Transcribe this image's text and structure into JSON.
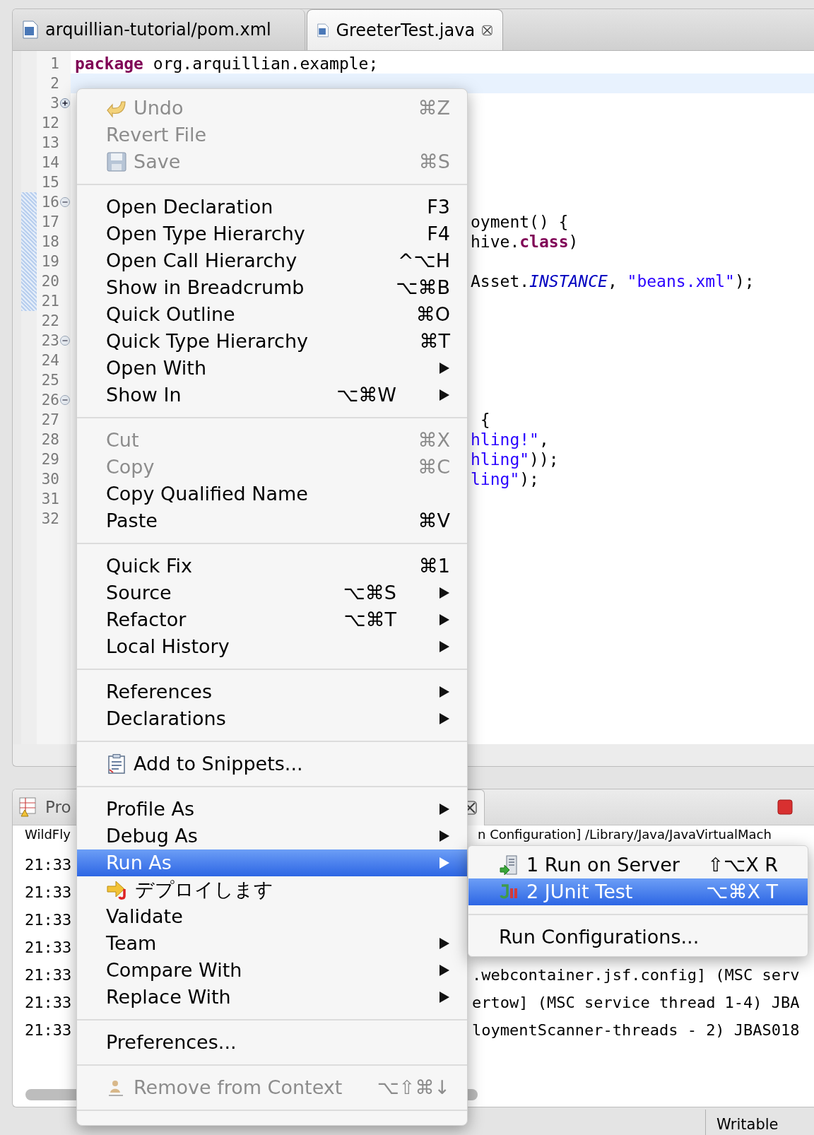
{
  "editor_tabs": [
    {
      "label": "arquillian-tutorial/pom.xml",
      "selected": false
    },
    {
      "label": "GreeterTest.java",
      "selected": true
    }
  ],
  "code_lines": [
    {
      "number": "1",
      "segments": [
        {
          "text": "package",
          "kind": "keyword"
        },
        {
          "text": " org.arquillian.example;",
          "kind": "plain"
        }
      ]
    },
    {
      "number": "2",
      "current": true
    },
    {
      "number": "3",
      "folded": true
    },
    {
      "number": "12"
    },
    {
      "number": "13"
    },
    {
      "number": "14"
    },
    {
      "number": "15"
    },
    {
      "number": "16",
      "folded": false,
      "marked": true
    },
    {
      "number": "17",
      "marked": true,
      "segments": [
        {
          "text": "oyment() {",
          "kind": "plain"
        }
      ]
    },
    {
      "number": "18",
      "marked": true,
      "segments": [
        {
          "text": "hive.",
          "kind": "plain"
        },
        {
          "text": "class",
          "kind": "keyword"
        },
        {
          "text": ")",
          "kind": "plain"
        }
      ]
    },
    {
      "number": "19",
      "marked": true
    },
    {
      "number": "20",
      "marked": true,
      "segments": [
        {
          "text": "Asset.",
          "kind": "plain"
        },
        {
          "text": "INSTANCE",
          "kind": "constant"
        },
        {
          "text": ", ",
          "kind": "plain"
        },
        {
          "text": "\"beans.xml\"",
          "kind": "string"
        },
        {
          "text": ");",
          "kind": "plain"
        }
      ]
    },
    {
      "number": "21",
      "marked": true
    },
    {
      "number": "22"
    },
    {
      "number": "23",
      "folded": false
    },
    {
      "number": "24"
    },
    {
      "number": "25"
    },
    {
      "number": "26",
      "folded": false
    },
    {
      "number": "27",
      "segments": [
        {
          "text": " {",
          "kind": "plain"
        }
      ]
    },
    {
      "number": "28",
      "segments": [
        {
          "text": "hling!\"",
          "kind": "string"
        },
        {
          "text": ",",
          "kind": "plain"
        }
      ]
    },
    {
      "number": "29",
      "segments": [
        {
          "text": "hling\"",
          "kind": "string"
        },
        {
          "text": "));",
          "kind": "plain"
        }
      ]
    },
    {
      "number": "30",
      "segments": [
        {
          "text": "ling\"",
          "kind": "string"
        },
        {
          "text": ");",
          "kind": "plain"
        }
      ]
    },
    {
      "number": "31"
    },
    {
      "number": "32"
    }
  ],
  "context_menu": {
    "sections": [
      [
        {
          "label": "Undo",
          "shortcut": "⌘Z",
          "has_icon": true,
          "disabled": true,
          "submenu": false,
          "selected": false
        },
        {
          "label": "Revert File",
          "disabled": true,
          "submenu": false,
          "selected": false
        },
        {
          "label": "Save",
          "shortcut": "⌘S",
          "has_icon": true,
          "disabled": true,
          "submenu": false,
          "selected": false
        }
      ],
      [
        {
          "label": "Open Declaration",
          "shortcut": "F3",
          "disabled": false,
          "submenu": false,
          "selected": false
        },
        {
          "label": "Open Type Hierarchy",
          "shortcut": "F4",
          "disabled": false,
          "submenu": false,
          "selected": false
        },
        {
          "label": "Open Call Hierarchy",
          "shortcut": "^⌥H",
          "disabled": false,
          "submenu": false,
          "selected": false
        },
        {
          "label": "Show in Breadcrumb",
          "shortcut": "⌥⌘B",
          "disabled": false,
          "submenu": false,
          "selected": false
        },
        {
          "label": "Quick Outline",
          "shortcut": "⌘O",
          "disabled": false,
          "submenu": false,
          "selected": false
        },
        {
          "label": "Quick Type Hierarchy",
          "shortcut": "⌘T",
          "disabled": false,
          "submenu": false,
          "selected": false
        },
        {
          "label": "Open With",
          "disabled": false,
          "submenu": true,
          "selected": false
        },
        {
          "label": "Show In",
          "shortcut": "⌥⌘W",
          "disabled": false,
          "submenu": true,
          "selected": false
        }
      ],
      [
        {
          "label": "Cut",
          "shortcut": "⌘X",
          "disabled": true,
          "submenu": false,
          "selected": false
        },
        {
          "label": "Copy",
          "shortcut": "⌘C",
          "disabled": true,
          "submenu": false,
          "selected": false
        },
        {
          "label": "Copy Qualified Name",
          "disabled": false,
          "submenu": false,
          "selected": false
        },
        {
          "label": "Paste",
          "shortcut": "⌘V",
          "disabled": false,
          "submenu": false,
          "selected": false
        }
      ],
      [
        {
          "label": "Quick Fix",
          "shortcut": "⌘1",
          "disabled": false,
          "submenu": false,
          "selected": false
        },
        {
          "label": "Source",
          "shortcut": "⌥⌘S",
          "disabled": false,
          "submenu": true,
          "selected": false
        },
        {
          "label": "Refactor",
          "shortcut": "⌥⌘T",
          "disabled": false,
          "submenu": true,
          "selected": false
        },
        {
          "label": "Local History",
          "disabled": false,
          "submenu": true,
          "selected": false
        }
      ],
      [
        {
          "label": "References",
          "disabled": false,
          "submenu": true,
          "selected": false
        },
        {
          "label": "Declarations",
          "disabled": false,
          "submenu": true,
          "selected": false
        }
      ],
      [
        {
          "label": "Add to Snippets...",
          "has_icon": true,
          "disabled": false,
          "submenu": false,
          "selected": false
        }
      ],
      [
        {
          "label": "Profile As",
          "disabled": false,
          "submenu": true,
          "selected": false
        },
        {
          "label": "Debug As",
          "disabled": false,
          "submenu": true,
          "selected": false
        },
        {
          "label": "Run As",
          "disabled": false,
          "submenu": true,
          "selected": true
        },
        {
          "label": "デプロイします",
          "has_icon": true,
          "disabled": false,
          "submenu": false,
          "selected": false
        },
        {
          "label": "Validate",
          "disabled": false,
          "submenu": false,
          "selected": false
        },
        {
          "label": "Team",
          "disabled": false,
          "submenu": true,
          "selected": false
        },
        {
          "label": "Compare With",
          "disabled": false,
          "submenu": true,
          "selected": false
        },
        {
          "label": "Replace With",
          "disabled": false,
          "submenu": true,
          "selected": false
        }
      ],
      [
        {
          "label": "Preferences...",
          "disabled": false,
          "submenu": false,
          "selected": false
        }
      ],
      [
        {
          "label": "Remove from Context",
          "shortcut": "⌥⇧⌘↓",
          "has_icon": true,
          "disabled": true,
          "submenu": false,
          "selected": false
        }
      ]
    ]
  },
  "run_as_submenu": {
    "sections": [
      [
        {
          "label": "1 Run on Server",
          "shortcut": "⇧⌥X R",
          "has_icon": true,
          "selected": false
        },
        {
          "label": "2 JUnit Test",
          "shortcut": "⌥⌘X T",
          "has_icon": true,
          "selected": true
        }
      ],
      [
        {
          "label": "Run Configurations...",
          "selected": false
        }
      ]
    ]
  },
  "bottom_panel": {
    "tab_label": "Pro",
    "console_header": "WildFly",
    "console_header_tail": "n Configuration] /Library/Java/JavaVirtualMach",
    "rows": [
      {
        "time": "21:33"
      },
      {
        "time": "21:33"
      },
      {
        "time": "21:33"
      },
      {
        "time": "21:33"
      },
      {
        "time": "21:33",
        "text": ".webcontainer.jsf.config] (MSC serv"
      },
      {
        "time": "21:33",
        "text": "ertow] (MSC service thread 1-4) JBA"
      },
      {
        "time": "21:33",
        "text": "loymentScanner-threads - 2) JBAS018"
      }
    ]
  },
  "status_bar": {
    "text": "Writable"
  }
}
